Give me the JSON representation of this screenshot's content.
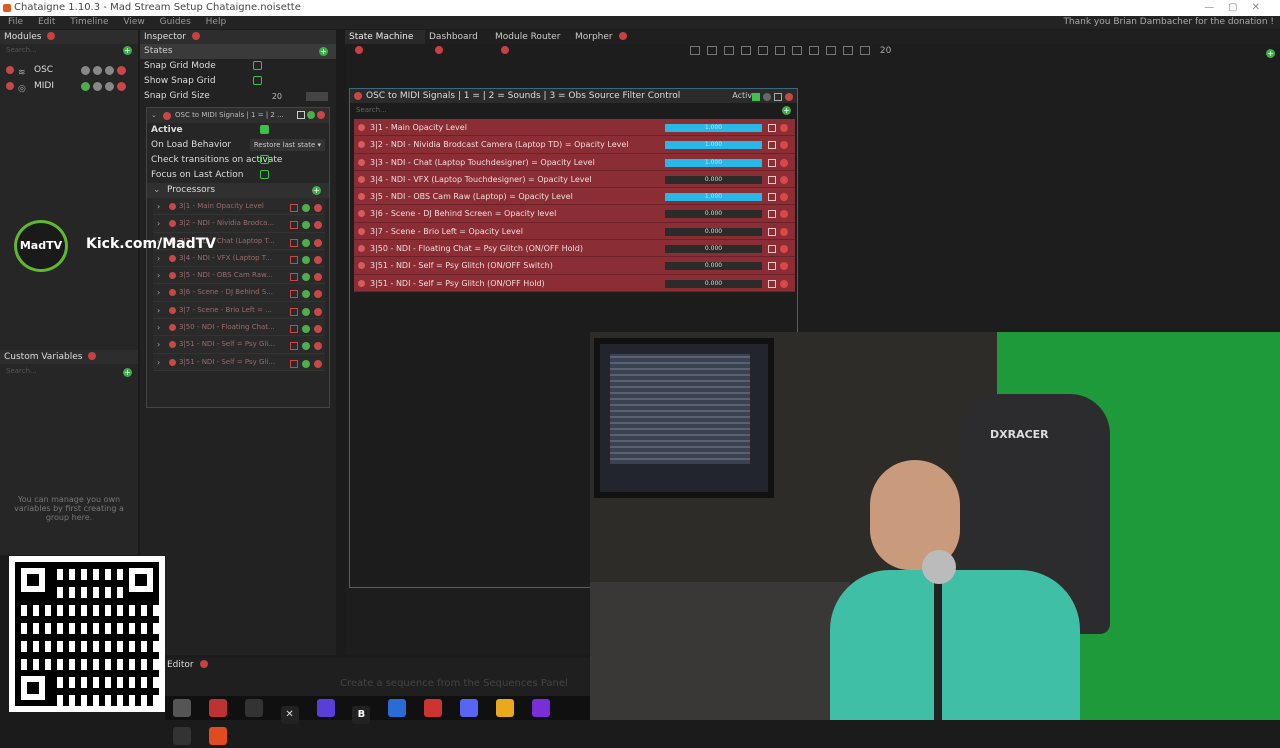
{
  "app": {
    "title": "Chataigne 1.10.3 - Mad Stream Setup Chataigne.noisette",
    "thanks": "Thank you Brian Dambacher for the donation !",
    "menu": [
      "File",
      "Edit",
      "Timeline",
      "View",
      "Guides",
      "Help"
    ]
  },
  "modules": {
    "title": "Modules",
    "search": "Search...",
    "items": [
      {
        "label": "OSC",
        "icon": "osc-icon"
      },
      {
        "label": "MIDI",
        "icon": "midi-icon"
      }
    ]
  },
  "custom_vars": {
    "title": "Custom Variables",
    "search": "Search...",
    "hint": "You can manage you own variables by first creating a group here."
  },
  "inspector": {
    "title": "Inspector",
    "states_label": "States",
    "snap_grid_mode": "Snap Grid Mode",
    "show_snap_grid": "Show Snap Grid",
    "snap_grid_size": "Snap Grid Size",
    "snap_grid_size_value": "20",
    "state_title": "OSC to MIDI Signals | 1 = | 2 ...",
    "active": "Active",
    "on_load": "On Load Behavior",
    "on_load_value": "Restore last state",
    "check_transitions": "Check transitions on activate",
    "focus_last": "Focus on Last Action",
    "processors": "Processors",
    "proc_items": [
      "3|1 - Main Opacity Level",
      "3|2 - NDI - Nividia Brodca...",
      "3|3 - NDI - Chat (Laptop T...",
      "3|4 - NDI - VFX (Laptop T...",
      "3|5 - NDI - OBS Cam Raw...",
      "3|6 - Scene - DJ Behind S...",
      "3|7 - Scene - Brio Left = ...",
      "3|50 - NDI - Floating Chat...",
      "3|51 - NDI - Self = Psy Gli...",
      "3|51 - NDI - Self = Psy Gli..."
    ]
  },
  "tabs": [
    "State Machine",
    "Dashboard",
    "Module Router",
    "Morpher"
  ],
  "toolbar": {
    "grid_value": "20"
  },
  "state_node": {
    "title": "OSC to MIDI Signals | 1 =  | 2 = Sounds | 3 = Obs Source Filter Control",
    "active_label": "Active",
    "search": "Search...",
    "actions": [
      {
        "label": "3|1 - Main Opacity Level",
        "value": "1.000",
        "fill": 1.0
      },
      {
        "label": "3|2 - NDI - Nividia Brodcast Camera (Laptop TD) = Opacity Level",
        "value": "1.000",
        "fill": 1.0
      },
      {
        "label": "3|3 - NDI - Chat (Laptop Touchdesigner) = Opacity Level",
        "value": "1.000",
        "fill": 1.0
      },
      {
        "label": "3|4 - NDI - VFX (Laptop Touchdesigner) = Opacity Level",
        "value": "0.000",
        "fill": 0
      },
      {
        "label": "3|5 - NDI - OBS Cam Raw (Laptop) = Opacity Level",
        "value": "1.000",
        "fill": 1.0
      },
      {
        "label": "3|6 - Scene - DJ Behind Screen = Opacity level",
        "value": "0.000",
        "fill": 0
      },
      {
        "label": "3|7 - Scene - Brio Left = Opacity Level",
        "value": "0.000",
        "fill": 0
      },
      {
        "label": "3|50 - NDI - Floating Chat = Psy Glitch (ON/OFF Hold)",
        "value": "0.000",
        "fill": 0
      },
      {
        "label": "3|51 - NDI - Self = Psy Glitch (ON/OFF Switch)",
        "value": "0.000",
        "fill": 0
      },
      {
        "label": "3|51 - NDI - Self = Psy Glitch (ON/OFF Hold)",
        "value": "0.000",
        "fill": 0
      }
    ]
  },
  "overlay": {
    "kick_badge": "MadTV",
    "kick_text": "Kick.com/MadTV",
    "chair_brand": "DXRACER"
  },
  "sequence": {
    "title": "Editor",
    "hint": "Create a sequence from the Sequences Panel"
  },
  "taskbar": [
    "B"
  ],
  "colors": {
    "accent": "#27b8e8",
    "action_bg": "#8a2d35",
    "ok": "#3cc14a",
    "danger": "#c84848"
  }
}
